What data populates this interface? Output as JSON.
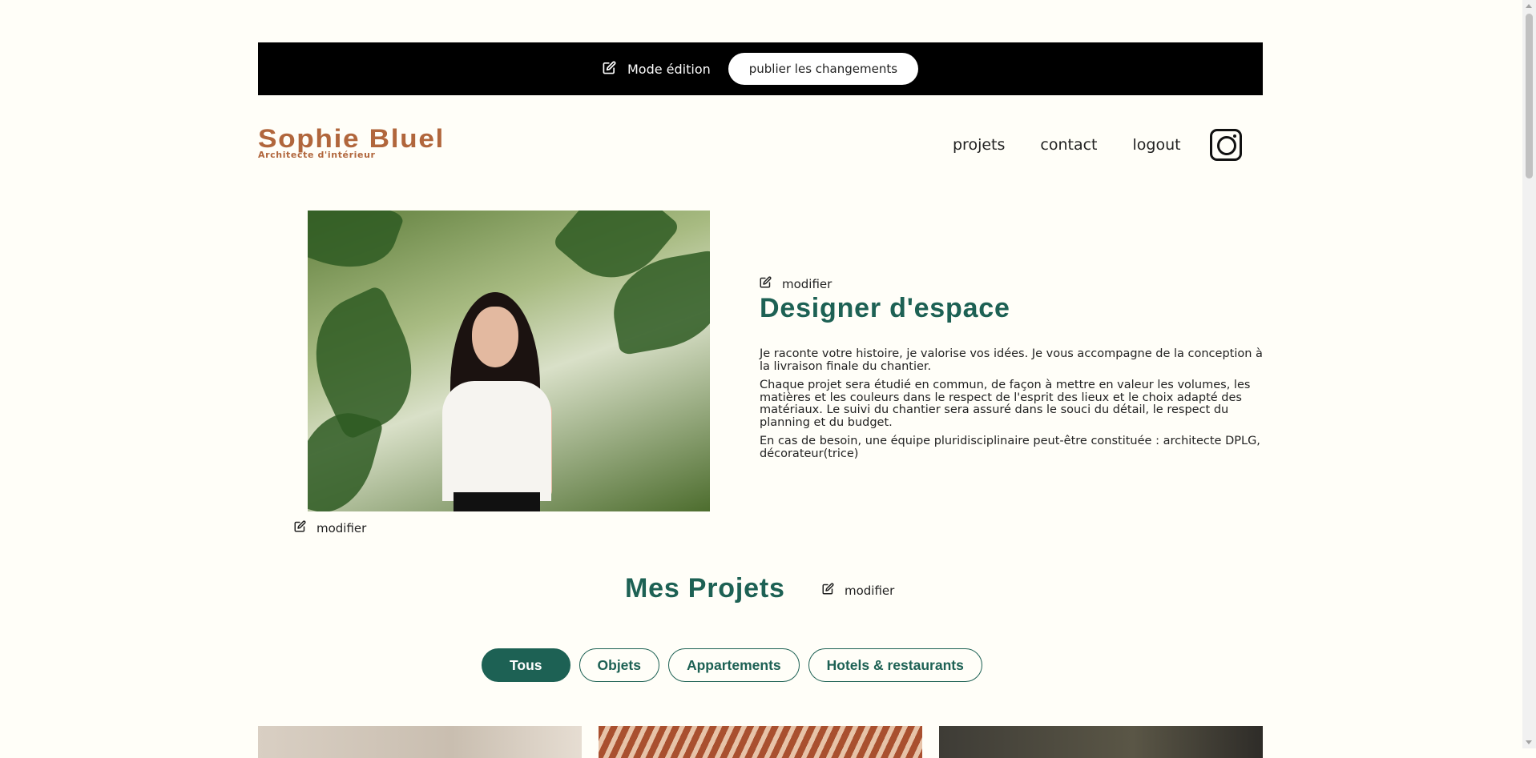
{
  "edit_banner": {
    "mode_label": "Mode édition",
    "publish_label": "publier les changements"
  },
  "header": {
    "logo_title": "Sophie Bluel",
    "logo_subtitle": "Architecte d'intérieur",
    "nav": [
      "projets",
      "contact",
      "logout"
    ],
    "social_icon": "instagram-icon"
  },
  "introduction": {
    "photo_modify_label": "modifier",
    "text_modify_label": "modifier",
    "title": "Designer d'espace",
    "paragraphs": [
      "Je raconte votre histoire, je valorise vos idées. Je vous accompagne de la conception à la livraison finale du chantier.",
      "Chaque projet sera étudié en commun, de façon à mettre en valeur les volumes, les matières et les couleurs dans le respect de l'esprit des lieux et le choix adapté des matériaux. Le suivi du chantier sera assuré dans le souci du détail, le respect du planning et du budget.",
      "En cas de besoin, une équipe pluridisciplinaire peut-être constituée : architecte DPLG, décorateur(trice)"
    ]
  },
  "portfolio": {
    "title": "Mes Projets",
    "modify_label": "modifier",
    "filters": [
      "Tous",
      "Objets",
      "Appartements",
      "Hotels & restaurants"
    ],
    "active_filter": "Tous"
  },
  "colors": {
    "accent": "#1d6154",
    "brand": "#b1663c",
    "background": "#fffef8",
    "edit_bar": "#000000"
  }
}
